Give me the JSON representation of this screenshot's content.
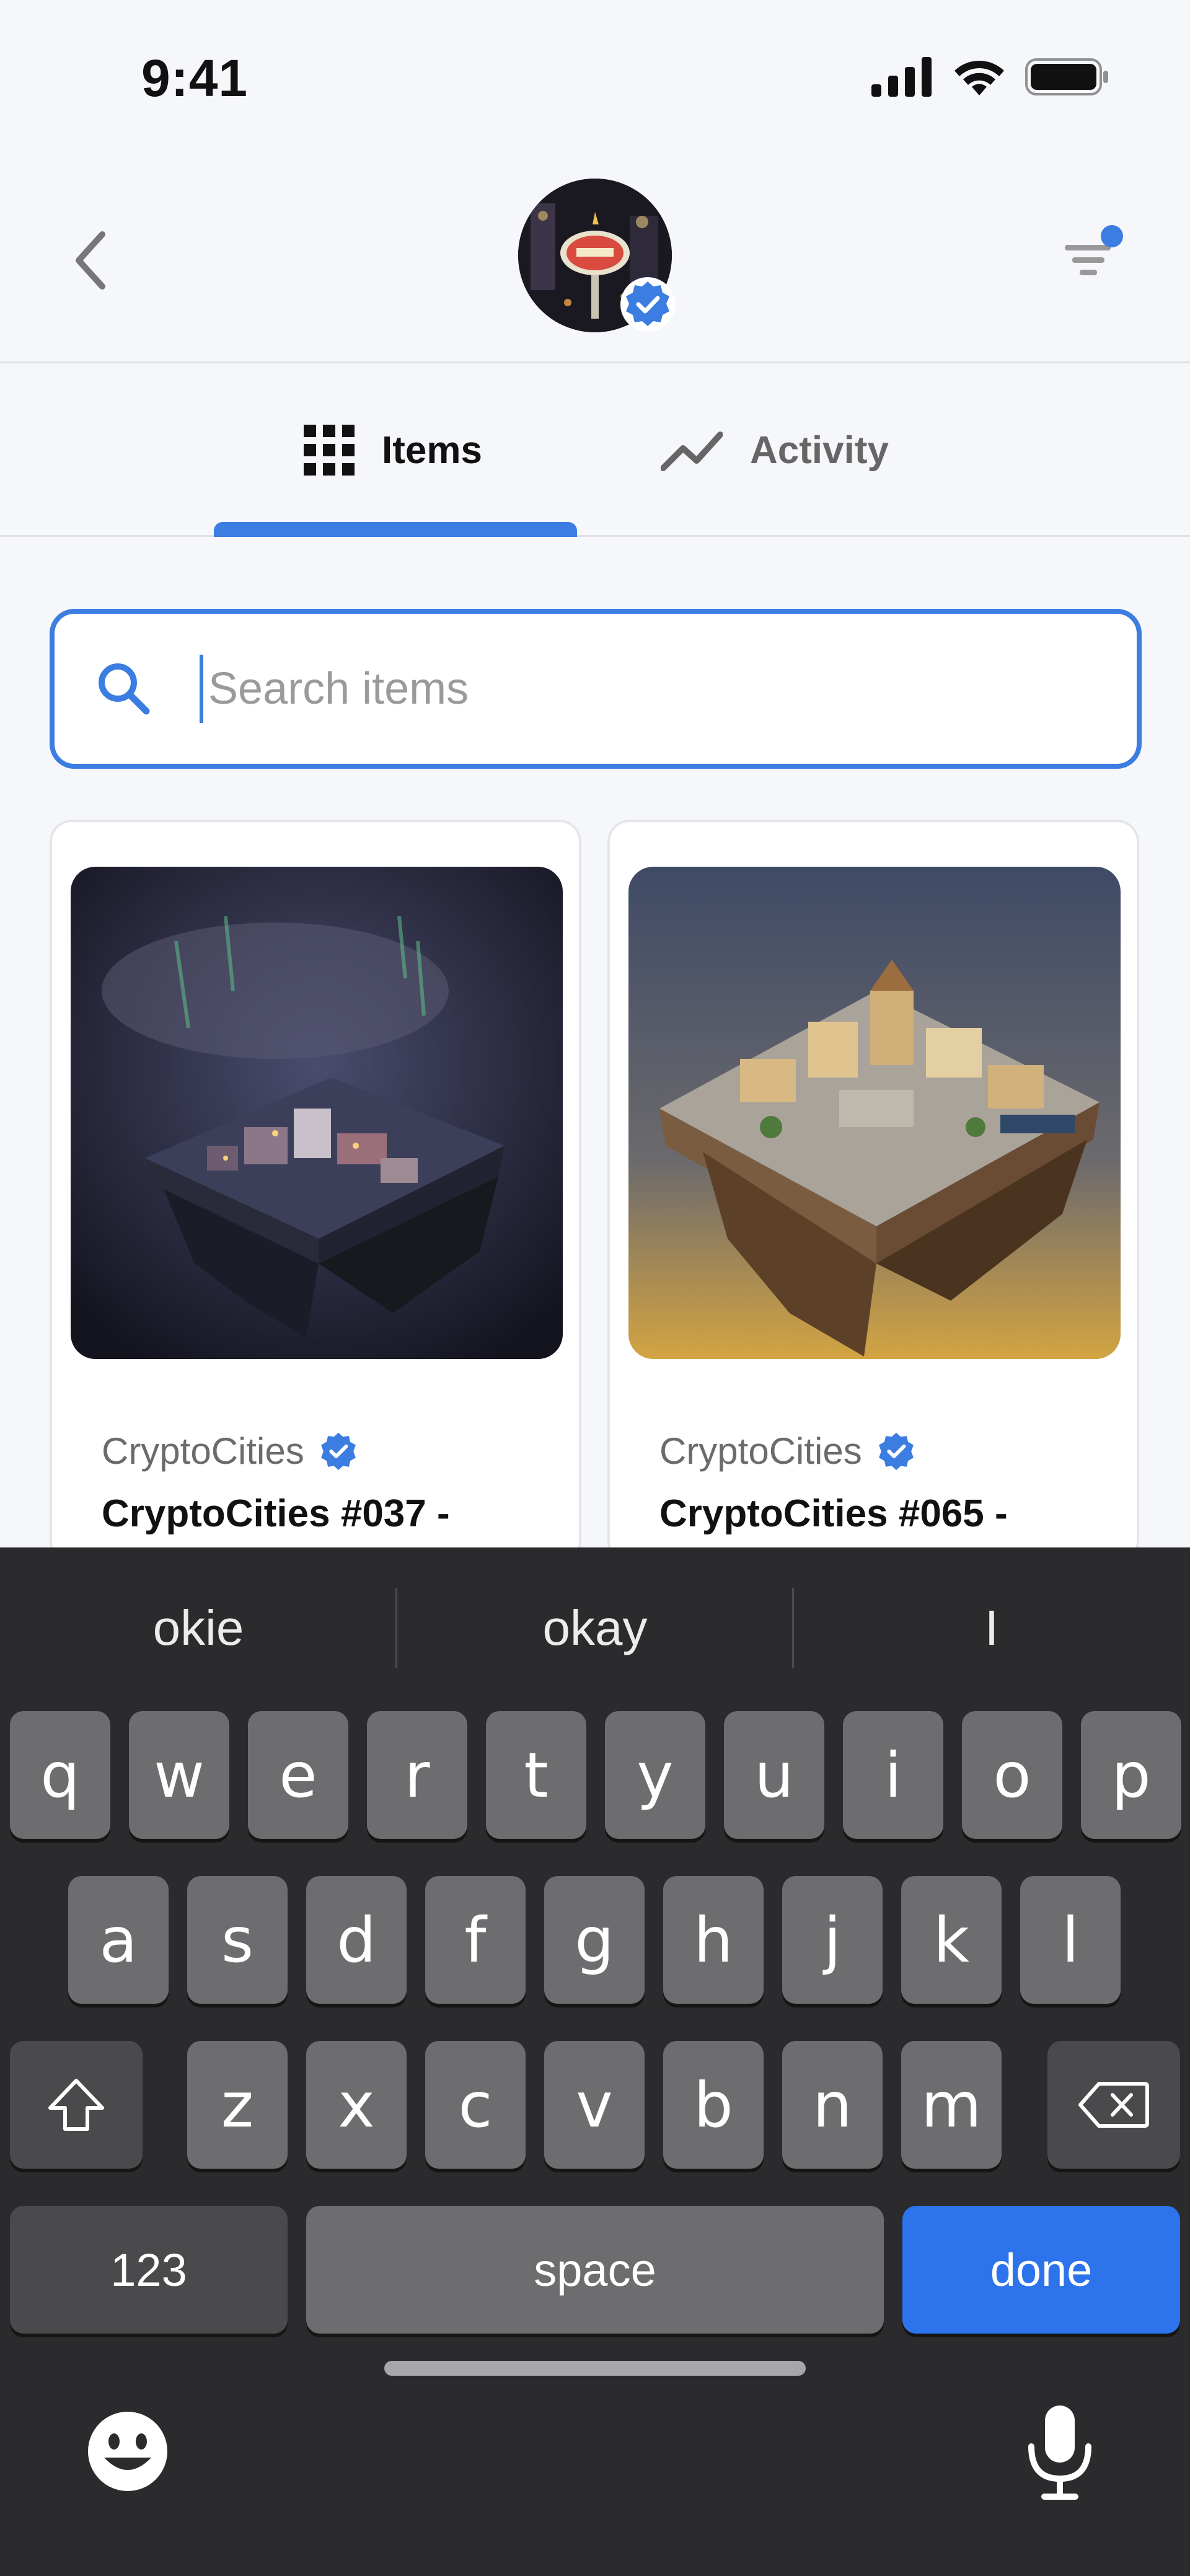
{
  "status_bar": {
    "time": "9:41"
  },
  "header": {
    "collection_verified": true,
    "filter_active": true
  },
  "tabs": [
    {
      "label": "Items",
      "active": true
    },
    {
      "label": "Activity",
      "active": false
    }
  ],
  "search": {
    "placeholder": "Search items",
    "value": ""
  },
  "cards": [
    {
      "collection": "CryptoCities",
      "title": "CryptoCities #037 -"
    },
    {
      "collection": "CryptoCities",
      "title": "CryptoCities #065 -"
    }
  ],
  "keyboard": {
    "suggestions": [
      "okie",
      "okay",
      "I"
    ],
    "row1": [
      "q",
      "w",
      "e",
      "r",
      "t",
      "y",
      "u",
      "i",
      "o",
      "p"
    ],
    "row2": [
      "a",
      "s",
      "d",
      "f",
      "g",
      "h",
      "j",
      "k",
      "l"
    ],
    "row3": [
      "z",
      "x",
      "c",
      "v",
      "b",
      "n",
      "m"
    ],
    "numbers_label": "123",
    "space_label": "space",
    "done_label": "done"
  },
  "colors": {
    "accent": "#3b7de0",
    "keyboard_bg": "#2b2b2d",
    "done": "#2d73eb"
  }
}
